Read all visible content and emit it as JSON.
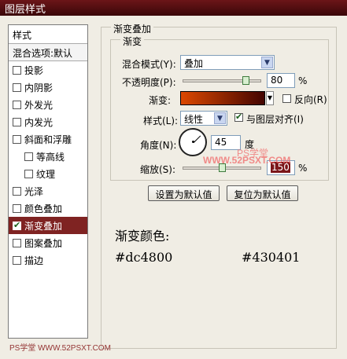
{
  "window": {
    "title": "图层样式"
  },
  "sidebar": {
    "header": "样式",
    "blend": "混合选项:默认",
    "items": [
      {
        "label": "投影",
        "checked": false,
        "sub": false,
        "active": false
      },
      {
        "label": "内阴影",
        "checked": false,
        "sub": false,
        "active": false
      },
      {
        "label": "外发光",
        "checked": false,
        "sub": false,
        "active": false
      },
      {
        "label": "内发光",
        "checked": false,
        "sub": false,
        "active": false
      },
      {
        "label": "斜面和浮雕",
        "checked": false,
        "sub": false,
        "active": false
      },
      {
        "label": "等高线",
        "checked": false,
        "sub": true,
        "active": false
      },
      {
        "label": "纹理",
        "checked": false,
        "sub": true,
        "active": false
      },
      {
        "label": "光泽",
        "checked": false,
        "sub": false,
        "active": false
      },
      {
        "label": "颜色叠加",
        "checked": false,
        "sub": false,
        "active": false
      },
      {
        "label": "渐变叠加",
        "checked": true,
        "sub": false,
        "active": true
      },
      {
        "label": "图案叠加",
        "checked": false,
        "sub": false,
        "active": false
      },
      {
        "label": "描边",
        "checked": false,
        "sub": false,
        "active": false
      }
    ]
  },
  "panel": {
    "title": "渐变叠加",
    "group_title": "渐变",
    "blend_mode_label": "混合模式(Y):",
    "blend_mode_value": "叠加",
    "opacity_label": "不透明度(P):",
    "opacity_value": "80",
    "opacity_level": 0.8,
    "percent": "%",
    "gradient_label": "渐变:",
    "reverse_label": "反向(R)",
    "style_label": "样式(L):",
    "style_value": "线性",
    "align_label": "与图层对齐(I)",
    "align_checked": true,
    "angle_label": "角度(N):",
    "angle_value": "45",
    "degree": "度",
    "scale_label": "缩放(S):",
    "scale_value": "150",
    "scale_percent": "%",
    "scale_level": 0.5,
    "default_button": "设置为默认值",
    "reset_button": "复位为默认值"
  },
  "notes": {
    "heading": "渐变颜色:",
    "color_start": "#dc4800",
    "color_end": "#430401"
  },
  "watermarks": {
    "center_line1": "PS学堂",
    "center_line2": "WWW.52PSXT.COM",
    "bottom": "PS学堂 WWW.52PSXT.COM"
  },
  "colors": {
    "title_bar": "#5a0f12",
    "active_item": "#7f2322",
    "gradient_start": "#dc4800",
    "gradient_end": "#430401"
  }
}
